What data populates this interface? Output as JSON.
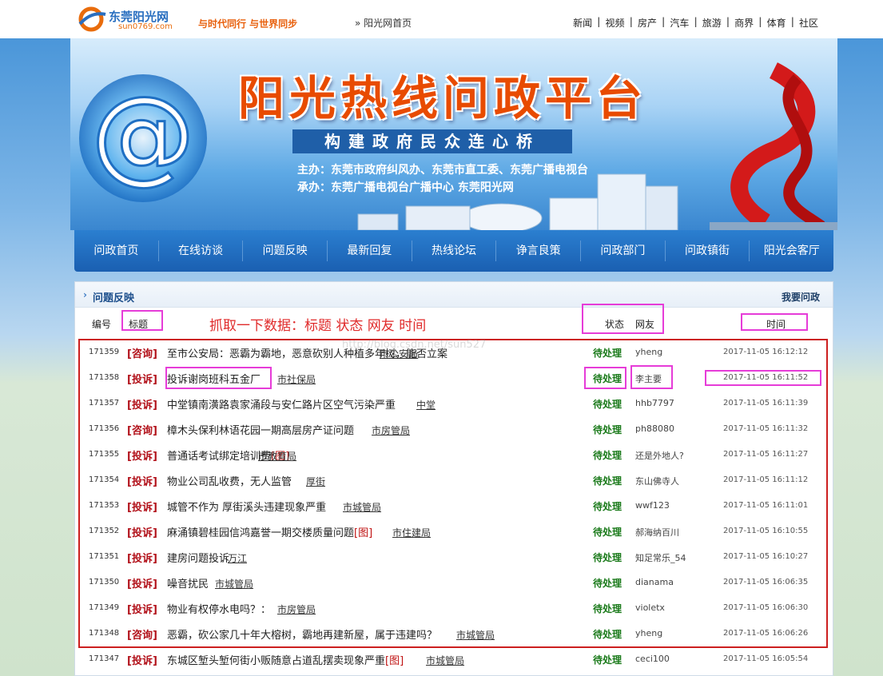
{
  "header": {
    "logo_name": "东莞阳光网",
    "logo_domain": "sun0769.com",
    "slogan": "与时代同行  与世界同步",
    "breadcrumb": "» 阳光网首页",
    "topnav": [
      "新闻",
      "视频",
      "房产",
      "汽车",
      "旅游",
      "商界",
      "体育",
      "社区"
    ]
  },
  "banner": {
    "title": "阳光热线问政平台",
    "subtitle": "构建政府民众连心桥",
    "host": "主办：东莞市政府纠风办、东莞市直工委、东莞广播电视台",
    "organizer": "承办：东莞广播电视台广播中心  东莞阳光网"
  },
  "mainnav": [
    "问政首页",
    "在线访谈",
    "问题反映",
    "最新回复",
    "热线论坛",
    "诤言良策",
    "问政部门",
    "问政镇街",
    "阳光会客厅"
  ],
  "panel": {
    "title": "问题反映",
    "ask_link": "我要问政",
    "columns": {
      "id": "编号",
      "title": "标题",
      "status": "状态",
      "user": "网友",
      "time": "时间"
    },
    "note": "抓取一下数据：标题  状态  网友  时间",
    "watermark": "http://blog.csdn.net/sun527"
  },
  "rows": [
    {
      "id": "171359",
      "tag": "[咨询]",
      "title": "至市公安局：恶霸为霸地，恶意砍别人种植多年树，能否立案",
      "img": "",
      "dept": "市公安局",
      "status": "待处理",
      "user": "yheng",
      "time": "2017-11-05 16:12:12"
    },
    {
      "id": "171358",
      "tag": "[投诉]",
      "title": "投诉谢岗班科五金厂",
      "img": "",
      "dept": "市社保局",
      "status": "待处理",
      "user": "李主要",
      "time": "2017-11-05 16:11:52"
    },
    {
      "id": "171357",
      "tag": "[投诉]",
      "title": "中堂镇南潢路袁家涌段与安仁路片区空气污染严重",
      "img": "",
      "dept": "中堂",
      "status": "待处理",
      "user": "hhb7797",
      "time": "2017-11-05 16:11:39"
    },
    {
      "id": "171356",
      "tag": "[咨询]",
      "title": "樟木头保利林语花园一期高层房产证问题",
      "img": "",
      "dept": "市房管局",
      "status": "待处理",
      "user": "ph88080",
      "time": "2017-11-05 16:11:32"
    },
    {
      "id": "171355",
      "tag": "[投诉]",
      "title": "普通话考试绑定培训费",
      "img": "[图]",
      "dept": "市教育局",
      "status": "待处理",
      "user": "还是外地人?",
      "time": "2017-11-05 16:11:27"
    },
    {
      "id": "171354",
      "tag": "[投诉]",
      "title": "物业公司乱收费，无人监管",
      "img": "",
      "dept": "厚街",
      "status": "待处理",
      "user": "东山佛寺人",
      "time": "2017-11-05 16:11:12"
    },
    {
      "id": "171353",
      "tag": "[投诉]",
      "title": "城管不作为  厚街溪头违建现象严重",
      "img": "",
      "dept": "市城管局",
      "status": "待处理",
      "user": "wwf123",
      "time": "2017-11-05 16:11:01"
    },
    {
      "id": "171352",
      "tag": "[投诉]",
      "title": "麻涌镇碧桂园信鸿嘉誉一期交楼质量问题",
      "img": "[图]",
      "dept": "市住建局",
      "status": "待处理",
      "user": "郝海纳百川",
      "time": "2017-11-05 16:10:55"
    },
    {
      "id": "171351",
      "tag": "[投诉]",
      "title": "建房问题投诉",
      "img": "",
      "dept": "万江",
      "status": "待处理",
      "user": "知足常乐_54",
      "time": "2017-11-05 16:10:27"
    },
    {
      "id": "171350",
      "tag": "[投诉]",
      "title": "噪音扰民",
      "img": "",
      "dept": "市城管局",
      "status": "待处理",
      "user": "dianama",
      "time": "2017-11-05 16:06:35"
    },
    {
      "id": "171349",
      "tag": "[投诉]",
      "title": "物业有权停水电吗？：",
      "img": "",
      "dept": "市房管局",
      "status": "待处理",
      "user": "violetx",
      "time": "2017-11-05 16:06:30"
    },
    {
      "id": "171348",
      "tag": "[咨询]",
      "title": "恶霸，砍公家几十年大榕树，霸地再建新屋，属于违建吗？",
      "img": "",
      "dept": "市城管局",
      "status": "待处理",
      "user": "yheng",
      "time": "2017-11-05 16:06:26"
    },
    {
      "id": "171347",
      "tag": "[投诉]",
      "title": "东城区堑头堑何街小贩随意占道乱摆卖现象严重",
      "img": "[图]",
      "dept": "市城管局",
      "status": "待处理",
      "user": "ceci100",
      "time": "2017-11-05 16:05:54"
    }
  ]
}
